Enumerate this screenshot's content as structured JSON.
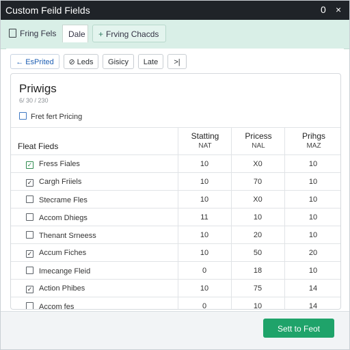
{
  "window": {
    "title": "Custom Feild Fields",
    "minimize_glyph": "0",
    "close_glyph": "×"
  },
  "top_tabs": [
    {
      "label": "Fring Fels",
      "icon": "document-icon"
    },
    {
      "label": "Dale"
    },
    {
      "label": "Frving Chacds",
      "icon": "plus-icon",
      "icon_glyph": "+"
    }
  ],
  "sub_tabs": [
    {
      "label": "EsPrited",
      "icon_glyph": "←"
    },
    {
      "label": "Leds",
      "icon_glyph": "⊘"
    },
    {
      "label": "Gisicy"
    },
    {
      "label": "Late"
    },
    {
      "label": ">|"
    }
  ],
  "card": {
    "title": "Priwigs",
    "code": "6/ 30 / 230",
    "checkbox_label": "Fret fert Pricing"
  },
  "table": {
    "header_label": "Fleat Fieds",
    "columns": [
      {
        "top": "Statting",
        "bottom": "NAT"
      },
      {
        "top": "Pricess",
        "bottom": "NAL"
      },
      {
        "top": "Prihgs",
        "bottom": "MAZ"
      }
    ],
    "rows": [
      {
        "name": "Fress Fiales",
        "check": "✓",
        "check_style": "green",
        "v1": "10",
        "v2": "X0",
        "v3": "10"
      },
      {
        "name": "Cargh Friiels",
        "check": "✓",
        "check_style": "dark",
        "v1": "10",
        "v2": "70",
        "v3": "10"
      },
      {
        "name": "Stecrame Fles",
        "check": "",
        "check_style": "dark",
        "v1": "10",
        "v2": "X0",
        "v3": "10"
      },
      {
        "name": "Accom Dhiegs",
        "check": "",
        "check_style": "dark",
        "v1": "11",
        "v2": "10",
        "v3": "10"
      },
      {
        "name": "Thenant Srneess",
        "check": "",
        "check_style": "dark",
        "v1": "10",
        "v2": "20",
        "v3": "10"
      },
      {
        "name": "Accum Fiches",
        "check": "✓",
        "check_style": "dark",
        "v1": "10",
        "v2": "50",
        "v3": "20"
      },
      {
        "name": "Imecange Fleid",
        "check": "",
        "check_style": "dark",
        "v1": "0",
        "v2": "18",
        "v3": "10"
      },
      {
        "name": "Action Phibes",
        "check": "✓",
        "check_style": "dark",
        "v1": "10",
        "v2": "75",
        "v3": "14"
      },
      {
        "name": "Accom fes",
        "check": "",
        "check_style": "dark",
        "v1": "0",
        "v2": "10",
        "v3": "14"
      }
    ]
  },
  "footer": {
    "primary_button": "Sett to Feot"
  },
  "colors": {
    "titlebar": "#1f2328",
    "topbar": "#d9efe7",
    "accent_blue": "#1e5fb4",
    "primary_green": "#1fa36a"
  }
}
